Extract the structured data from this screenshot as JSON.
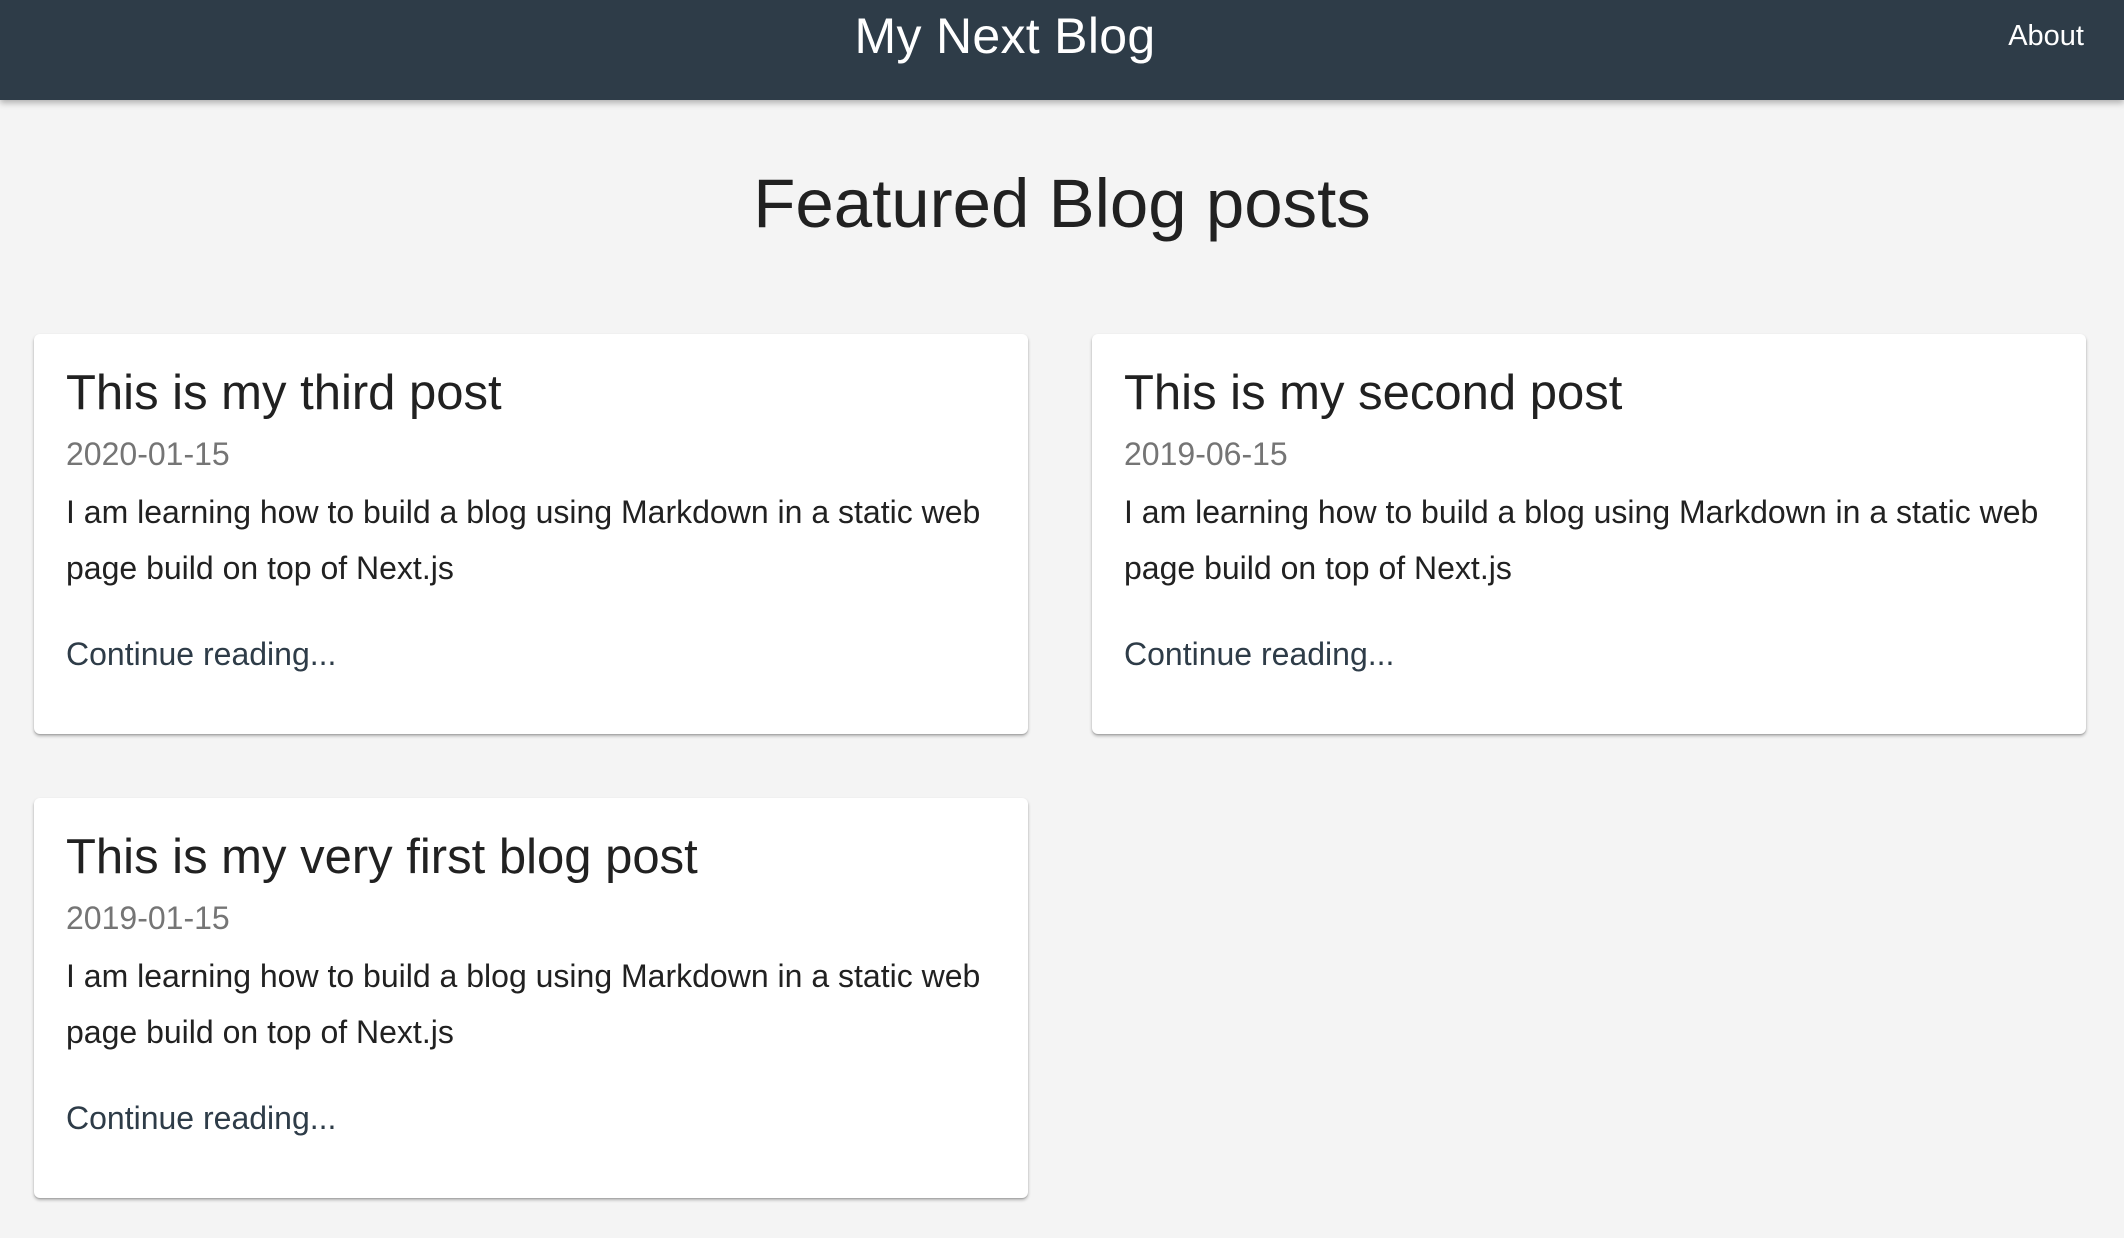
{
  "header": {
    "title": "My Next Blog",
    "about_label": "About"
  },
  "main": {
    "heading": "Featured Blog posts",
    "posts": [
      {
        "title": "This is my third post",
        "date": "2020-01-15",
        "excerpt": "I am learning how to build a blog using Markdown in a static web page build on top of Next.js",
        "link_label": "Continue reading..."
      },
      {
        "title": "This is my second post",
        "date": "2019-06-15",
        "excerpt": "I am learning how to build a blog using Markdown in a static web page build on top of Next.js",
        "link_label": "Continue reading..."
      },
      {
        "title": "This is my very first blog post",
        "date": "2019-01-15",
        "excerpt": "I am learning how to build a blog using Markdown in a static web page build on top of Next.js",
        "link_label": "Continue reading..."
      }
    ]
  },
  "colors": {
    "appbar": "#2e3c48",
    "background": "#f4f4f4",
    "card": "#ffffff",
    "date_text": "#757575"
  }
}
